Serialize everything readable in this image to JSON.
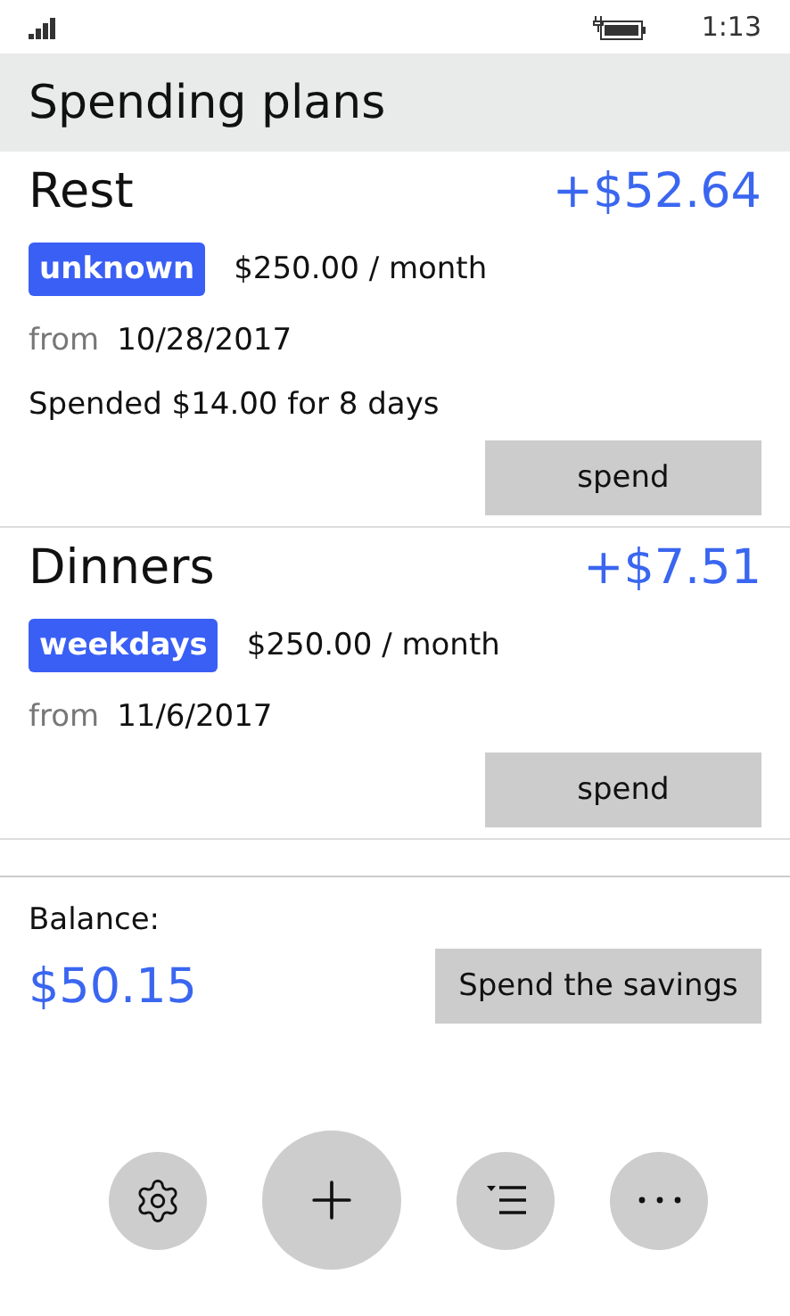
{
  "status_bar": {
    "time": "1:13"
  },
  "header": {
    "title": "Spending plans"
  },
  "plans": [
    {
      "name": "Rest",
      "amount": "+$52.64",
      "tag": "unknown",
      "rate": "$250.00 / month",
      "from_label": "from",
      "date": "10/28/2017",
      "note": "Spended $14.00 for 8 days",
      "button": "spend"
    },
    {
      "name": "Dinners",
      "amount": "+$7.51",
      "tag": "weekdays",
      "rate": "$250.00 / month",
      "from_label": "from",
      "date": "11/6/2017",
      "button": "spend"
    }
  ],
  "balance": {
    "label": "Balance:",
    "value": "$50.15",
    "button": "Spend the savings"
  },
  "app_bar": [
    {
      "kind": "settings"
    },
    {
      "kind": "add"
    },
    {
      "kind": "sort"
    },
    {
      "kind": "more"
    }
  ]
}
